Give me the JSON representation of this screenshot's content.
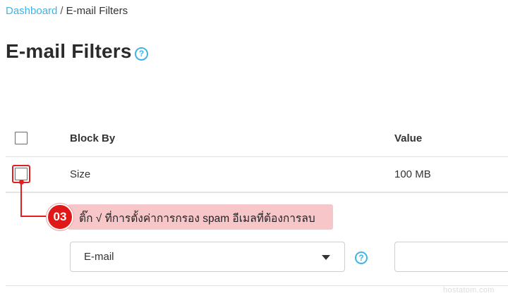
{
  "breadcrumb": {
    "home": "Dashboard",
    "separator": "/",
    "current": "E-mail Filters"
  },
  "page": {
    "title": "E-mail Filters",
    "help_glyph": "?"
  },
  "table": {
    "columns": {
      "block_by": "Block By",
      "value": "Value"
    },
    "rows": [
      {
        "block_by": "Size",
        "value": "100 MB",
        "checked": false
      }
    ]
  },
  "annotation": {
    "step": "03",
    "text": "ติ๊ก √ ที่การตั้งค่าการกรอง spam อีเมลที่ต้องการลบ"
  },
  "form": {
    "block_by_select": "E-mail",
    "value_input": ""
  },
  "watermark": "hostatom.com",
  "colors": {
    "link": "#3cb4e5",
    "highlight": "#e02020",
    "callout_bg": "#f7c6c9"
  }
}
